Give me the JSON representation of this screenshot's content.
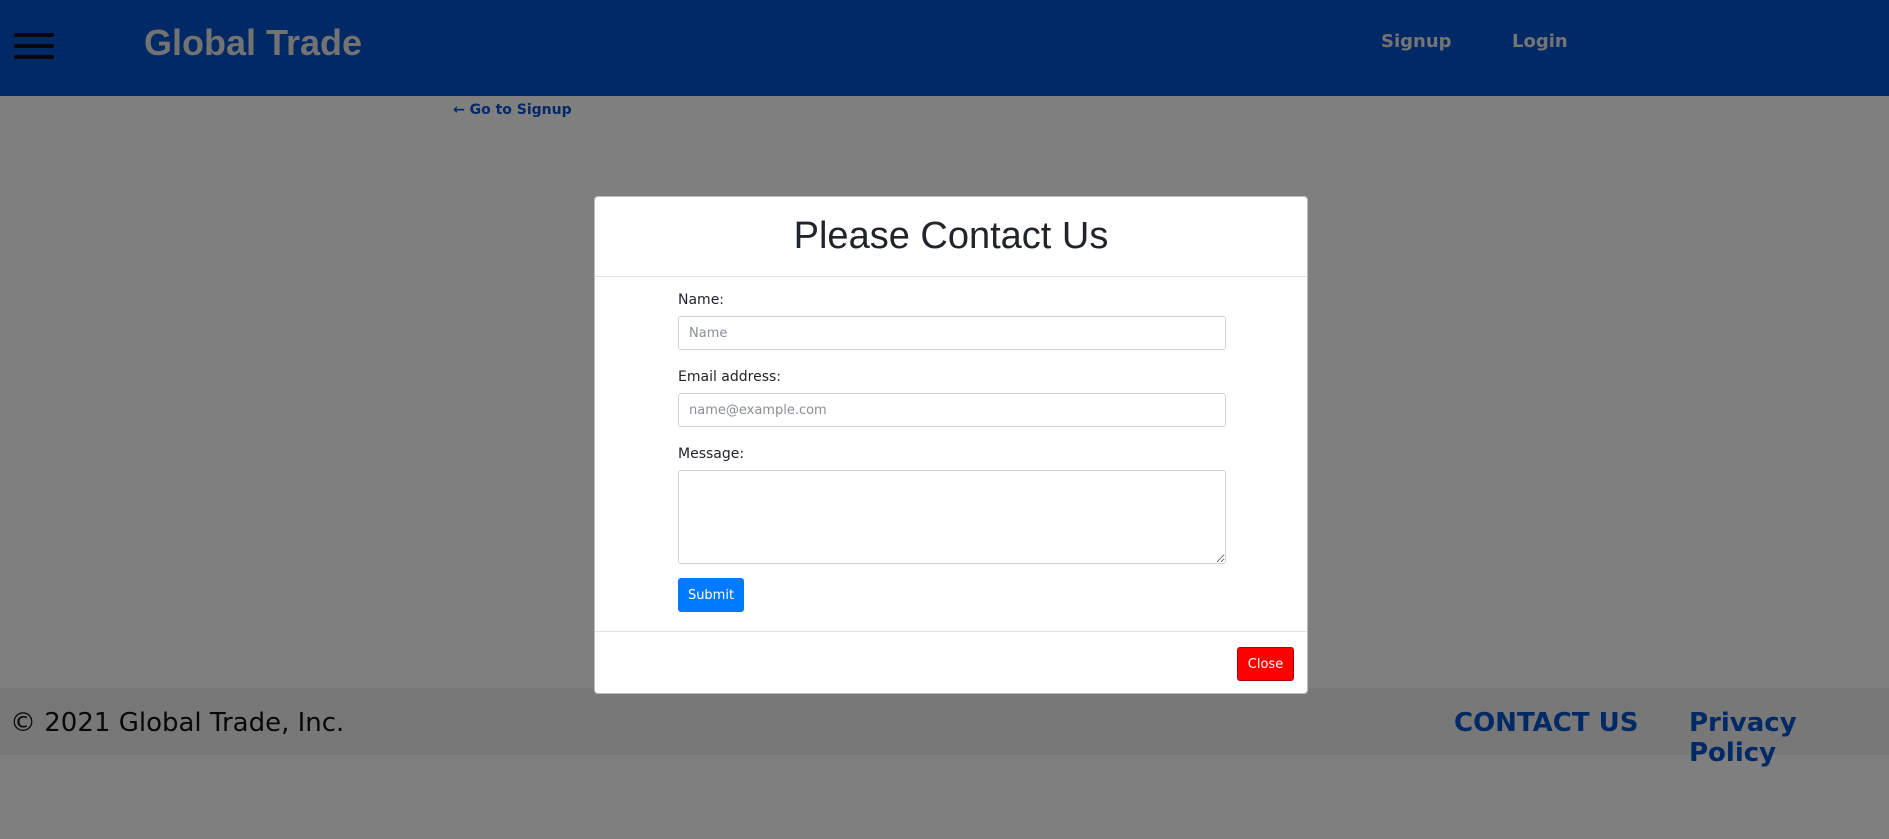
{
  "header": {
    "brand": "Global Trade",
    "nav_signup": "Signup",
    "nav_login": "Login"
  },
  "back_link": "← Go to Signup",
  "footer": {
    "copyright": "© 2021 Global Trade, Inc.",
    "contact": "CONTACT US",
    "privacy": "Privacy Policy"
  },
  "modal": {
    "title": "Please Contact Us",
    "name_label": "Name:",
    "name_placeholder": "Name",
    "name_value": "",
    "email_label": "Email address:",
    "email_placeholder": "name@example.com",
    "email_value": "",
    "message_label": "Message:",
    "message_value": "",
    "submit": "Submit",
    "close": "Close"
  },
  "colors": {
    "navbar": "#0052cc",
    "link": "#0052cc",
    "submit": "#007bff",
    "close": "#ff0000"
  }
}
